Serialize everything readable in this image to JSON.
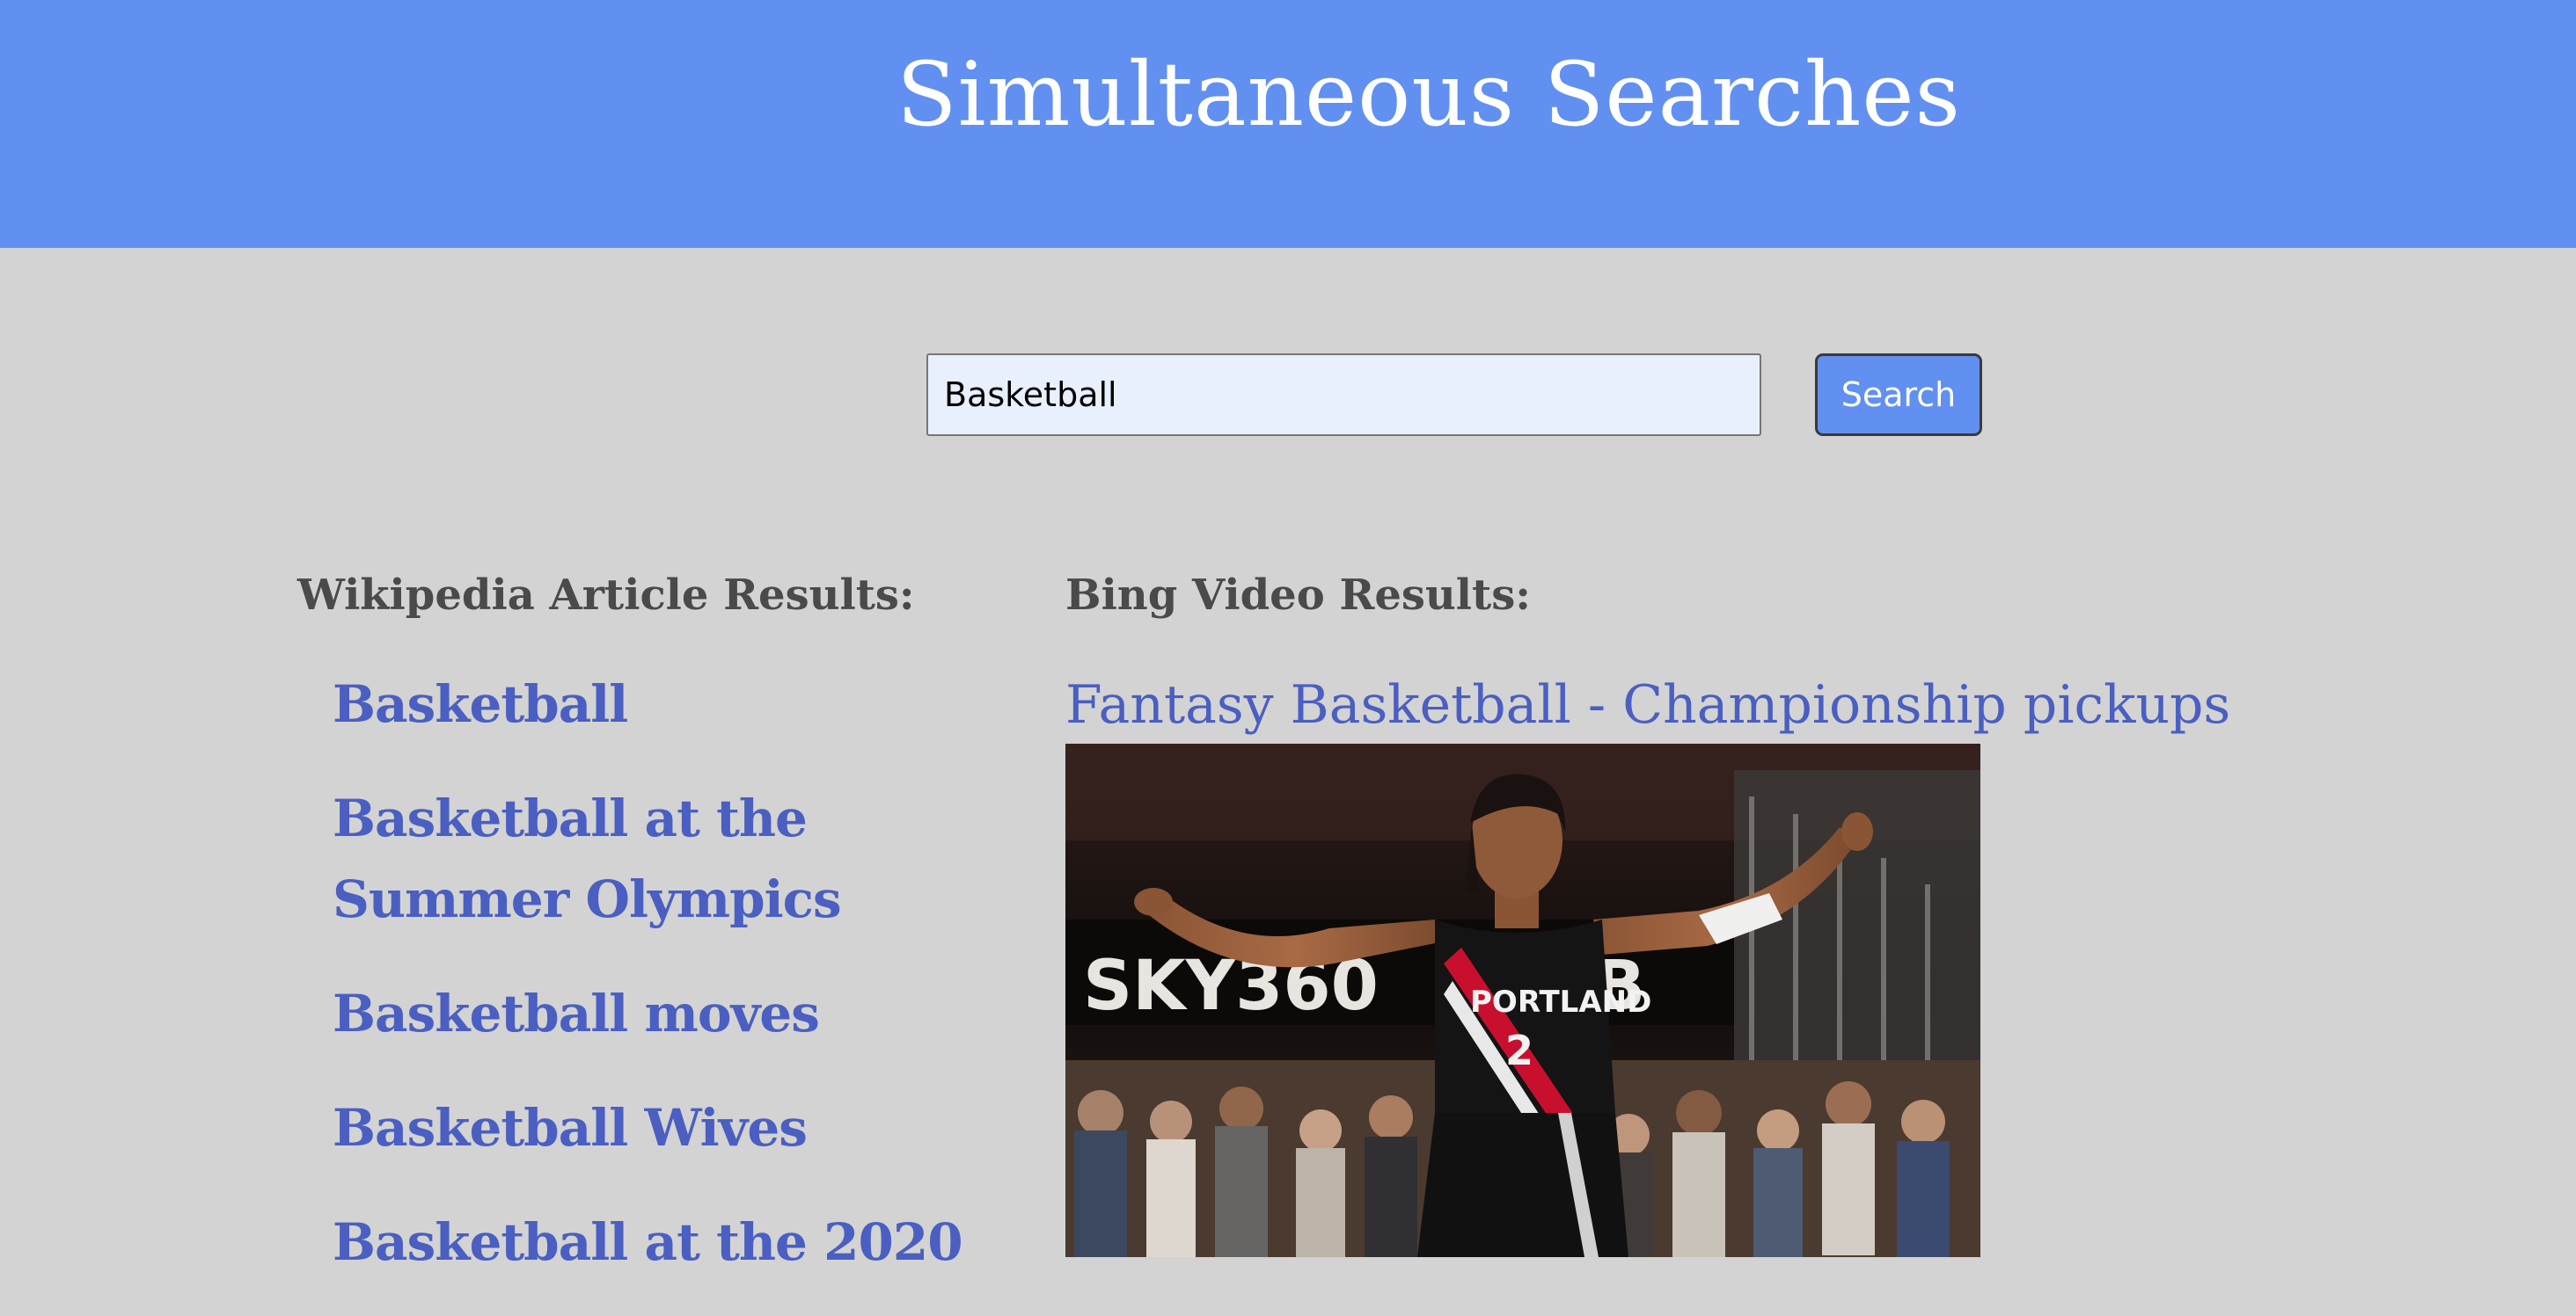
{
  "header": {
    "title": "Simultaneous Searches"
  },
  "search": {
    "value": "Basketball",
    "button_label": "Search"
  },
  "wikipedia": {
    "heading": "Wikipedia Article Results:",
    "results": [
      "Basketball",
      "Basketball at the Summer Olympics",
      "Basketball moves",
      "Basketball Wives",
      "Basketball at the 2020"
    ]
  },
  "bing": {
    "heading": "Bing Video Results:",
    "videos": [
      {
        "title": "Fantasy Basketball - Championship pickups",
        "thumbnail": {
          "arena_sign": "SKY360",
          "arena_sign_suffix": "B",
          "jersey_team": "PORTLAND",
          "jersey_number": "2"
        }
      }
    ]
  },
  "colors": {
    "header_bg": "#6190f0",
    "page_bg": "#d3d3d3",
    "link": "#4a5fc1",
    "heading": "#4a4a4a"
  }
}
